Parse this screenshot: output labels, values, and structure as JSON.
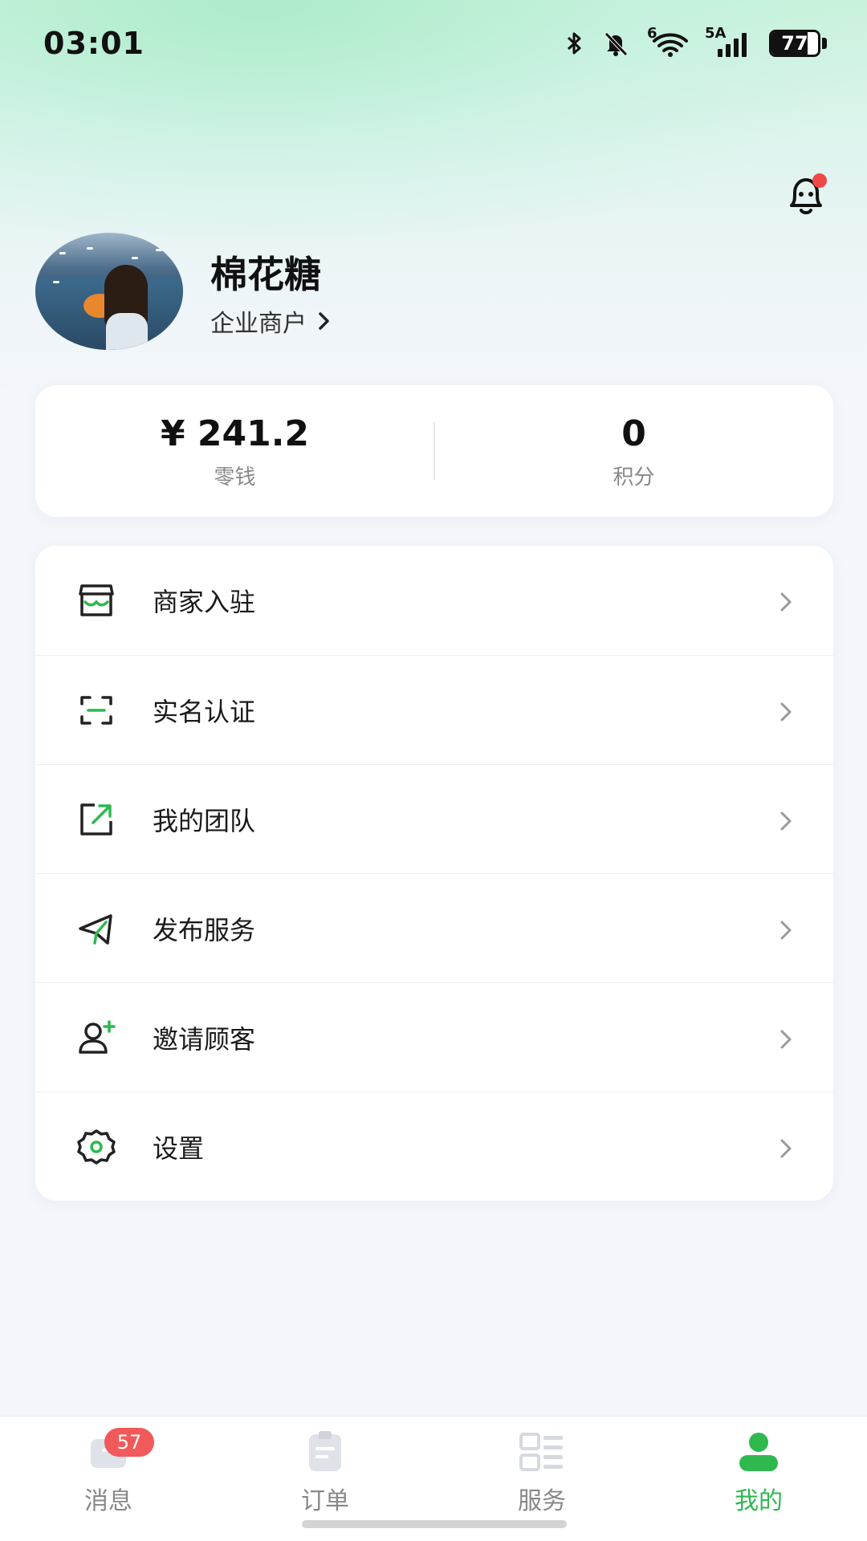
{
  "status_bar": {
    "time": "03:01",
    "network_label": "5A",
    "wifi_label": "6",
    "battery": "77",
    "battery_level": 0.77,
    "icons": [
      "bluetooth-icon",
      "mute-bell-icon",
      "wifi-icon",
      "signal-icon",
      "battery-icon"
    ]
  },
  "header": {
    "notification_icon": "bell-icon",
    "notification_dot_color": "#f04848"
  },
  "profile": {
    "name": "棉花糖",
    "user_type": "企业商户",
    "avatar": "avatar-photo"
  },
  "stats": {
    "balance_value": "¥ 241.2",
    "balance_label": "零钱",
    "points_value": "0",
    "points_label": "积分"
  },
  "menu": {
    "items": [
      {
        "label": "商家入驻",
        "icon": "store-icon"
      },
      {
        "label": "实名认证",
        "icon": "scan-icon"
      },
      {
        "label": "我的团队",
        "icon": "share-icon"
      },
      {
        "label": "发布服务",
        "icon": "send-icon"
      },
      {
        "label": "邀请顾客",
        "icon": "add-user-icon"
      },
      {
        "label": "设置",
        "icon": "gear-icon"
      }
    ]
  },
  "bottom_nav": {
    "items": [
      {
        "label": "消息",
        "icon": "message-icon",
        "badge": "57"
      },
      {
        "label": "订单",
        "icon": "clipboard-icon"
      },
      {
        "label": "服务",
        "icon": "grid-list-icon"
      },
      {
        "label": "我的",
        "icon": "profile-icon",
        "active": true
      }
    ],
    "active_color": "#2eb84e",
    "badge_color": "#f05a5a"
  },
  "colors": {
    "accent_green": "#2eb84e",
    "background": "#f4f6fb"
  }
}
